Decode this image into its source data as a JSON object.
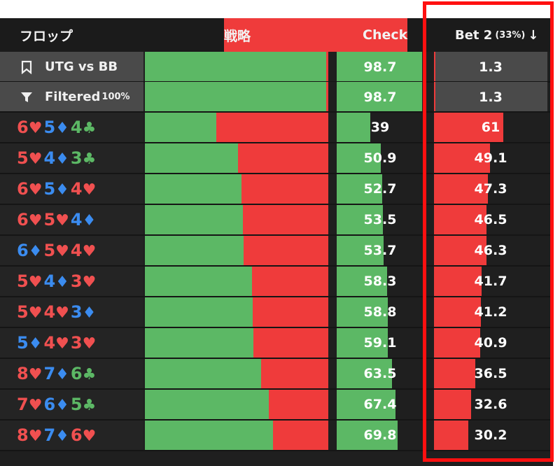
{
  "header": {
    "flop_label": "フロップ",
    "strategy_label": "戦略",
    "check_label": "Check",
    "bet_label": "Bet 2",
    "bet_pct": "(33%)",
    "sort_arrow": "↓"
  },
  "colors": {
    "check": "#5cb865",
    "bet": "#ef3b3b",
    "heart": "#f05050",
    "diamond": "#3b8cf0",
    "club": "#5cb865",
    "highlight": "#ff1010"
  },
  "summary": [
    {
      "icon": "bookmark-icon",
      "label": "UTG vs BB",
      "pct": "",
      "check": "98.7",
      "bet": "1.3"
    },
    {
      "icon": "filter-icon",
      "label": "Filtered",
      "pct": "100%",
      "check": "98.7",
      "bet": "1.3"
    }
  ],
  "rows": [
    {
      "cards": [
        {
          "rank": "6",
          "suit": "♥"
        },
        {
          "rank": "5",
          "suit": "♦"
        },
        {
          "rank": "4",
          "suit": "♣"
        }
      ],
      "check": "39",
      "bet": "61"
    },
    {
      "cards": [
        {
          "rank": "5",
          "suit": "♥"
        },
        {
          "rank": "4",
          "suit": "♦"
        },
        {
          "rank": "3",
          "suit": "♣"
        }
      ],
      "check": "50.9",
      "bet": "49.1"
    },
    {
      "cards": [
        {
          "rank": "6",
          "suit": "♥"
        },
        {
          "rank": "5",
          "suit": "♦"
        },
        {
          "rank": "4",
          "suit": "♥"
        }
      ],
      "check": "52.7",
      "bet": "47.3"
    },
    {
      "cards": [
        {
          "rank": "6",
          "suit": "♥"
        },
        {
          "rank": "5",
          "suit": "♥"
        },
        {
          "rank": "4",
          "suit": "♦"
        }
      ],
      "check": "53.5",
      "bet": "46.5"
    },
    {
      "cards": [
        {
          "rank": "6",
          "suit": "♦"
        },
        {
          "rank": "5",
          "suit": "♥"
        },
        {
          "rank": "4",
          "suit": "♥"
        }
      ],
      "check": "53.7",
      "bet": "46.3"
    },
    {
      "cards": [
        {
          "rank": "5",
          "suit": "♥"
        },
        {
          "rank": "4",
          "suit": "♦"
        },
        {
          "rank": "3",
          "suit": "♥"
        }
      ],
      "check": "58.3",
      "bet": "41.7"
    },
    {
      "cards": [
        {
          "rank": "5",
          "suit": "♥"
        },
        {
          "rank": "4",
          "suit": "♥"
        },
        {
          "rank": "3",
          "suit": "♦"
        }
      ],
      "check": "58.8",
      "bet": "41.2"
    },
    {
      "cards": [
        {
          "rank": "5",
          "suit": "♦"
        },
        {
          "rank": "4",
          "suit": "♥"
        },
        {
          "rank": "3",
          "suit": "♥"
        }
      ],
      "check": "59.1",
      "bet": "40.9"
    },
    {
      "cards": [
        {
          "rank": "8",
          "suit": "♥"
        },
        {
          "rank": "7",
          "suit": "♦"
        },
        {
          "rank": "6",
          "suit": "♣"
        }
      ],
      "check": "63.5",
      "bet": "36.5"
    },
    {
      "cards": [
        {
          "rank": "7",
          "suit": "♥"
        },
        {
          "rank": "6",
          "suit": "♦"
        },
        {
          "rank": "5",
          "suit": "♣"
        }
      ],
      "check": "67.4",
      "bet": "32.6"
    },
    {
      "cards": [
        {
          "rank": "8",
          "suit": "♥"
        },
        {
          "rank": "7",
          "suit": "♦"
        },
        {
          "rank": "6",
          "suit": "♥"
        }
      ],
      "check": "69.8",
      "bet": "30.2"
    }
  ]
}
